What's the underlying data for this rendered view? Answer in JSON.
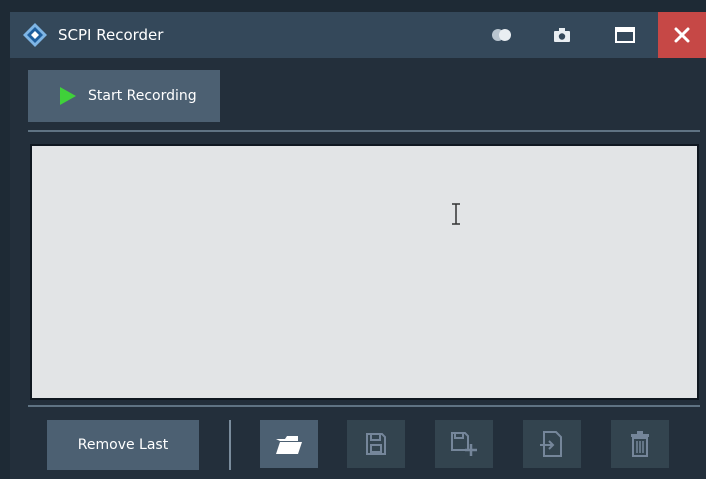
{
  "window": {
    "title": "SCPI Recorder",
    "icons": [
      "rs-logo-icon",
      "toggle-icon",
      "camera-icon",
      "maximize-icon",
      "close-icon"
    ]
  },
  "recorder": {
    "start_label": "Start Recording",
    "script_text": ""
  },
  "actions": {
    "remove_last_label": "Remove Last",
    "buttons": [
      {
        "name": "open-file-icon",
        "enabled": true
      },
      {
        "name": "save-icon",
        "enabled": false
      },
      {
        "name": "save-append-icon",
        "enabled": false
      },
      {
        "name": "export-icon",
        "enabled": false
      },
      {
        "name": "delete-icon",
        "enabled": false
      }
    ]
  },
  "colors": {
    "titlebar": "#34485a",
    "background": "#232f3b",
    "button": "#4c6072",
    "close": "#c64846",
    "play": "#3fd13a",
    "text_area": "#e2e4e6"
  }
}
